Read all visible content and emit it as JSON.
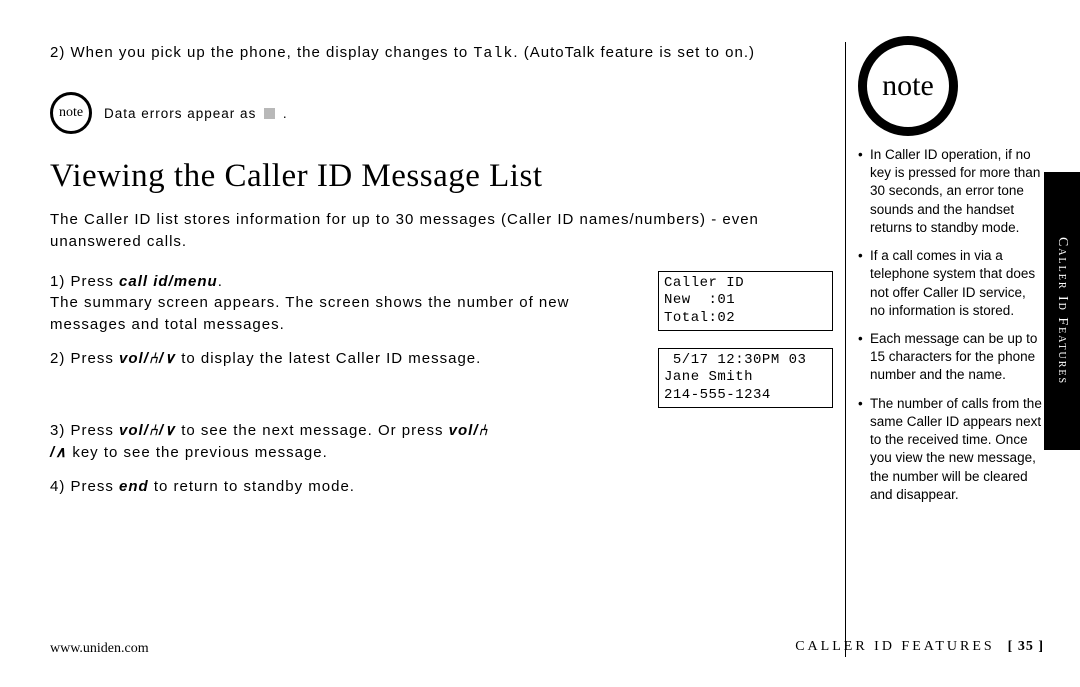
{
  "top": {
    "step2": "2) When you pick up the phone, the display changes to ",
    "talk_mono": "Talk",
    "step2_tail": ". (AutoTalk feature is set to on.)",
    "note_label": "note",
    "data_errors": "Data errors appear as"
  },
  "section": {
    "title": "Viewing the Caller ID Message List",
    "intro": "The Caller ID list stores information for up to 30 messages (Caller ID names/numbers) - even unanswered calls.",
    "step1_lead": "1) Press ",
    "step1_btn": "call id/menu",
    "step1_body": "The summary screen appears. The screen shows the number of new messages and total messages.",
    "step2_lead": "2) Press ",
    "step2_body": " to display the latest Caller ID message.",
    "step3_lead": "3) Press ",
    "step3_mid": " to see the next message. Or press ",
    "step3_tail": " key to see the previous message.",
    "step4_lead": "4) Press ",
    "step4_btn": "end",
    "step4_tail": " to return to standby mode.",
    "vol_label": "vol/",
    "lcd1": "Caller ID\nNew  :01\nTotal:02",
    "lcd2": " 5/17 12:30PM 03\nJane Smith\n214-555-1234"
  },
  "side": {
    "note_label": "note",
    "bullets": [
      "In Caller ID operation, if no key is pressed for more than 30 seconds, an error tone sounds and the handset returns to standby mode.",
      "If a call comes in via a telephone system that does not offer Caller ID service, no information is stored.",
      "Each message can be up to 15 characters for the phone number and the name.",
      "The number of calls from the same Caller ID appears next to the received time. Once you view the new message, the number will be cleared and disappear."
    ]
  },
  "footer": {
    "url": "www.uniden.com",
    "section_label": "CALLER ID FEATURES",
    "page": "[ 35 ]"
  },
  "tab": "Caller Id Features"
}
